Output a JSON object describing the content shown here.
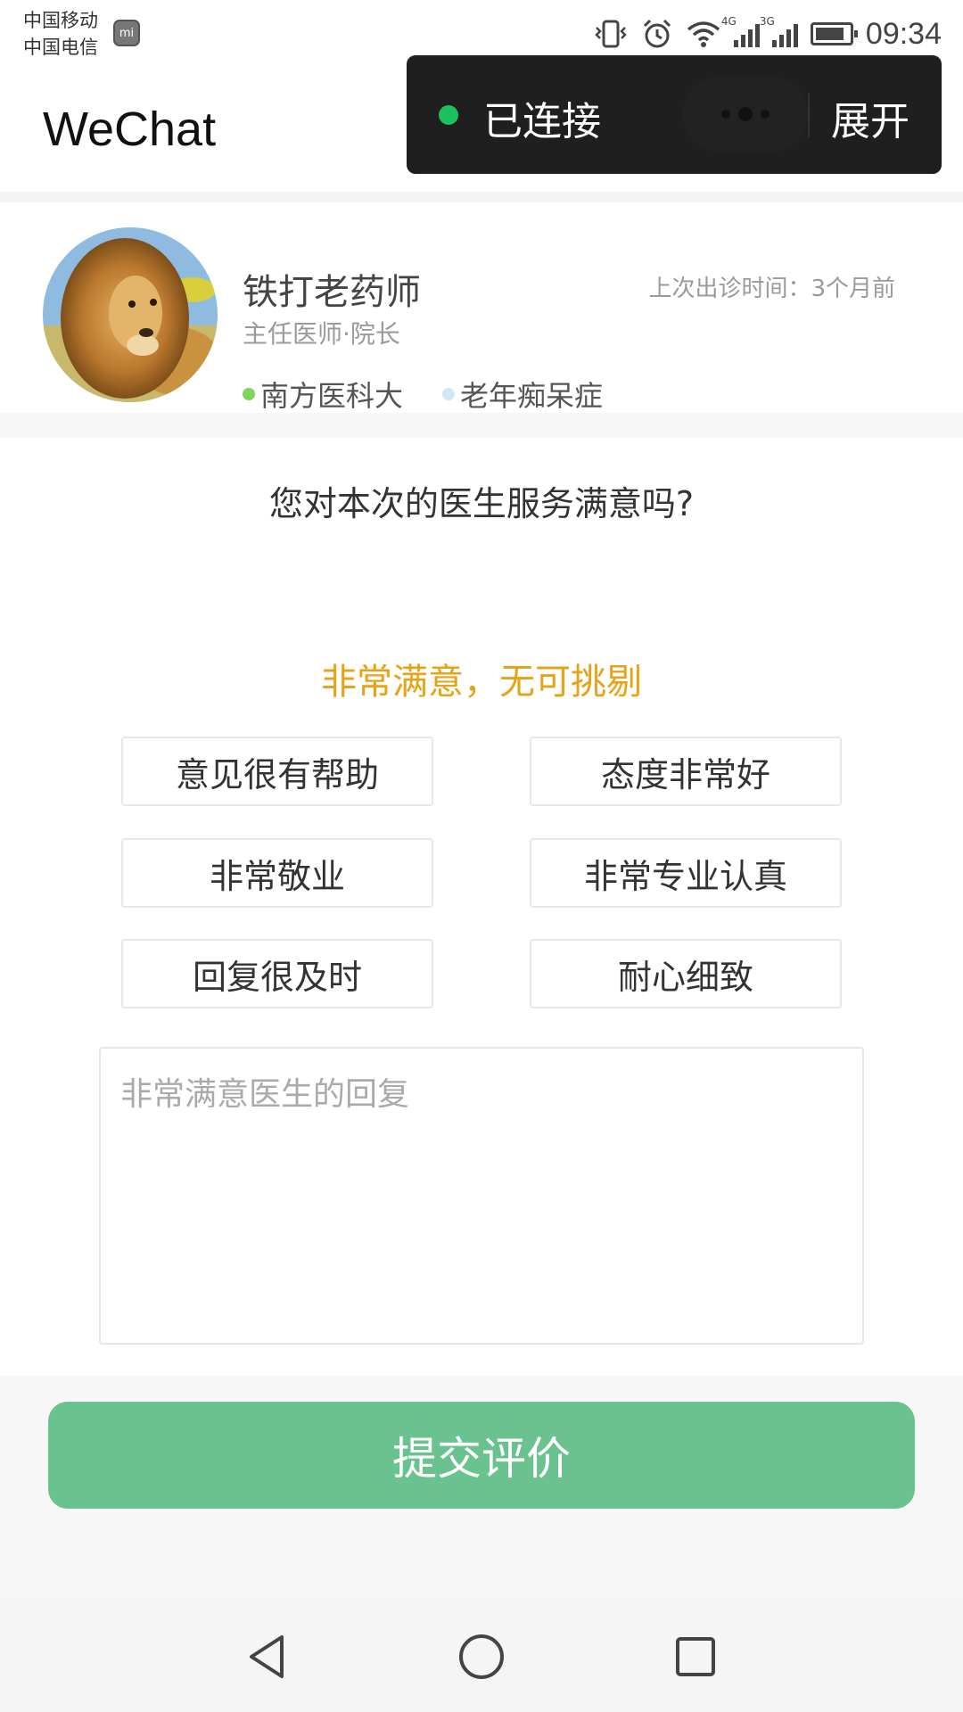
{
  "status_bar": {
    "carrier_1": "中国移动",
    "carrier_2": "中国电信",
    "network_1": "4G",
    "network_2": "3G",
    "time": "09:34",
    "mi_badge": "mi"
  },
  "header": {
    "app_title": "WeChat"
  },
  "capsule": {
    "status": "已连接",
    "expand_label": "展开",
    "status_color": "#19c15f"
  },
  "doctor": {
    "name": "铁打老药师",
    "title": "主任医师·院长",
    "last_visit": "上次出诊时间：3个月前",
    "tags": [
      {
        "label": "南方医科大",
        "color": "#7fd35a"
      },
      {
        "label": "老年痴呆症",
        "color": "#cfe8f2"
      }
    ]
  },
  "survey": {
    "question": "您对本次的医生服务满意吗?",
    "rating_text": "非常满意，无可挑剔",
    "rating_color": "#e6a315",
    "options": [
      "意见很有帮助",
      "态度非常好",
      "非常敬业",
      "非常专业认真",
      "回复很及时",
      "耐心细致"
    ],
    "comment_placeholder": "非常满意医生的回复",
    "comment_value": ""
  },
  "submit": {
    "label": "提交评价",
    "color": "#6ac38f"
  },
  "icons": {
    "back": "triangle-back-icon",
    "home": "circle-home-icon",
    "recents": "square-recents-icon"
  }
}
